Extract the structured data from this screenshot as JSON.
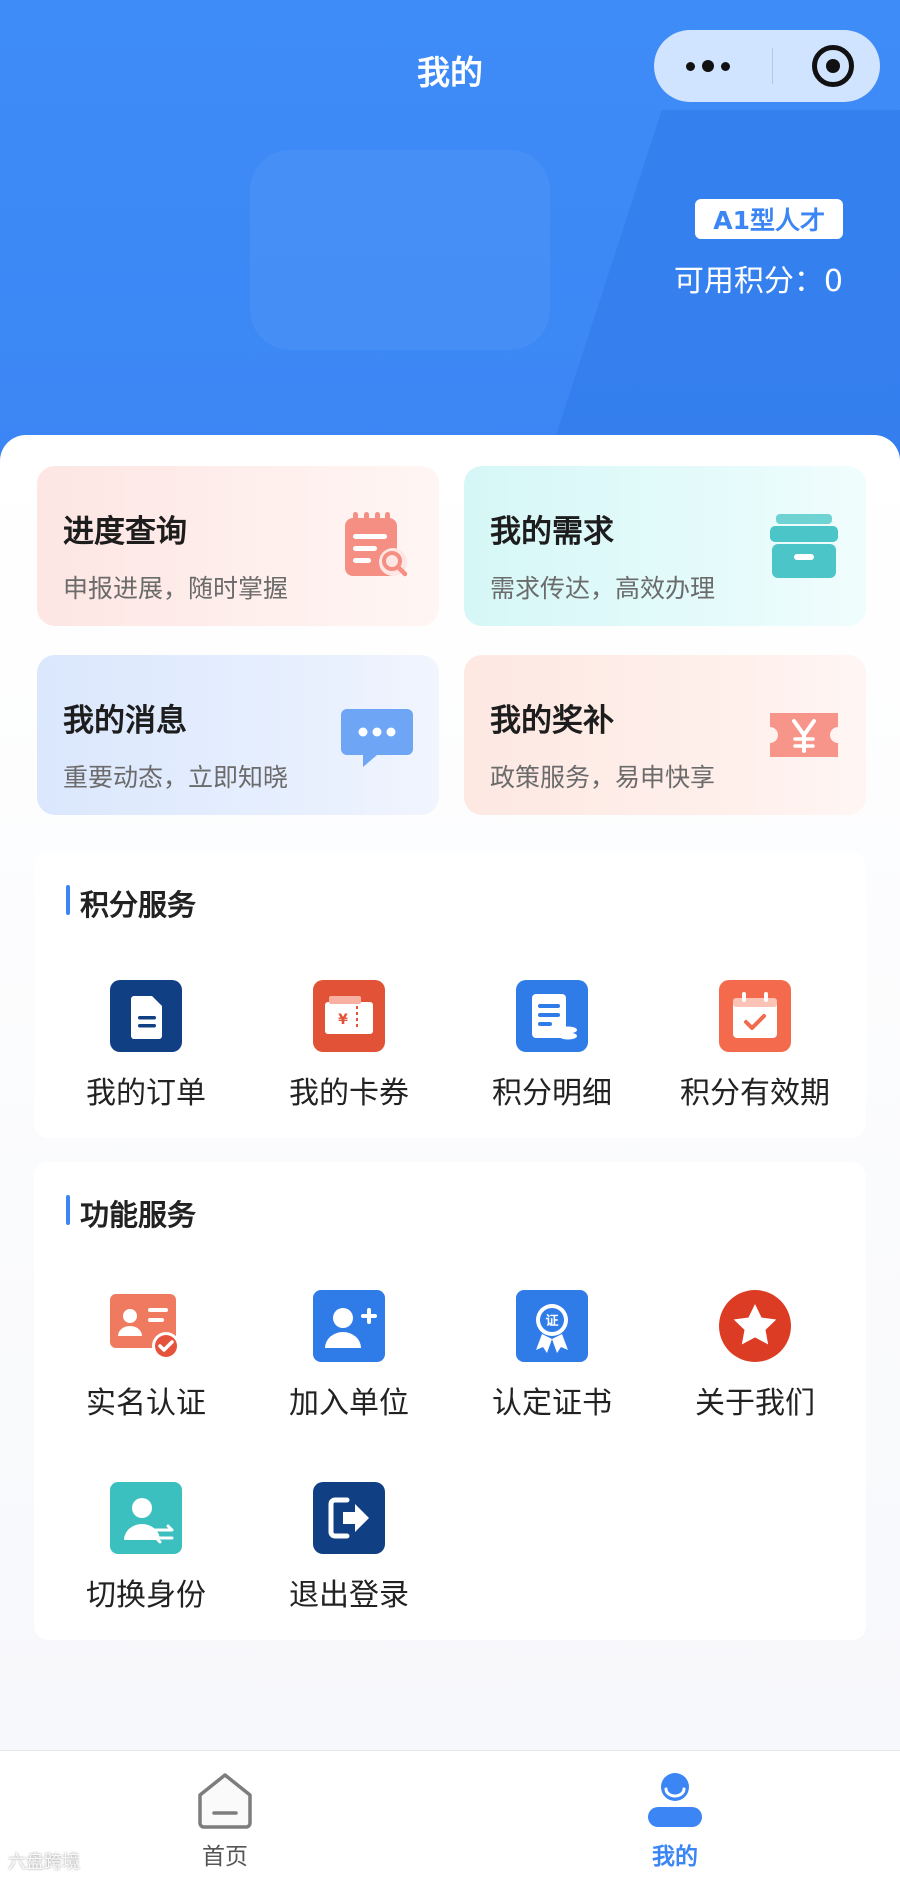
{
  "header": {
    "title": "我的",
    "badge": "A1型人才",
    "points_text": "可用积分：0"
  },
  "cards": [
    {
      "title": "进度查询",
      "subtitle": "申报进展，随时掌握",
      "icon": "calendar-search-icon"
    },
    {
      "title": "我的需求",
      "subtitle": "需求传达，高效办理",
      "icon": "archive-box-icon"
    },
    {
      "title": "我的消息",
      "subtitle": "重要动态，立即知晓",
      "icon": "chat-bubble-icon"
    },
    {
      "title": "我的奖补",
      "subtitle": "政策服务，易申快享",
      "icon": "yuan-ticket-icon"
    }
  ],
  "points_service": {
    "title": "积分服务",
    "items": [
      {
        "label": "我的订单",
        "icon": "order-document-icon"
      },
      {
        "label": "我的卡券",
        "icon": "coupon-icon"
      },
      {
        "label": "积分明细",
        "icon": "points-detail-icon"
      },
      {
        "label": "积分有效期",
        "icon": "calendar-check-icon"
      }
    ]
  },
  "function_service": {
    "title": "功能服务",
    "items": [
      {
        "label": "实名认证",
        "icon": "id-verify-icon"
      },
      {
        "label": "加入单位",
        "icon": "add-user-icon"
      },
      {
        "label": "认定证书",
        "icon": "certificate-icon"
      },
      {
        "label": "关于我们",
        "icon": "star-icon"
      },
      {
        "label": "切换身份",
        "icon": "switch-identity-icon"
      },
      {
        "label": "退出登录",
        "icon": "logout-icon"
      }
    ]
  },
  "tabbar": {
    "home": "首页",
    "mine": "我的"
  },
  "watermark": "六盘跨境",
  "colors": {
    "primary": "#3b86f4",
    "coral": "#f36a55",
    "navy": "#103f84",
    "teal": "#3bbfbf"
  }
}
